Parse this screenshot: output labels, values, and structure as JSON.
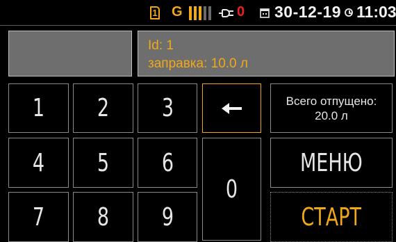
{
  "status": {
    "sim_number": "1",
    "network": "G",
    "signal_level": 0.6,
    "connection_status_value": "0",
    "date": "30-12-19",
    "time": "11:03",
    "icons": [
      "sim-icon",
      "signal-bars-icon",
      "plug-icon",
      "calendar-icon",
      "clock-icon"
    ],
    "colors": {
      "accent": "#f0a818",
      "alert": "#e8241c"
    }
  },
  "info": {
    "id_line": "Id: 1",
    "fuel_line": "заправка: 10.0 л"
  },
  "keypad": {
    "k1": "1",
    "k2": "2",
    "k3": "3",
    "k4": "4",
    "k5": "5",
    "k6": "6",
    "k7": "7",
    "k8": "8",
    "k9": "9",
    "k0": "0",
    "backspace_icon": "arrow-left-icon"
  },
  "total": {
    "label": "Всего отпущено:",
    "value": "20.0 л"
  },
  "menu_label": "МЕНЮ",
  "start_label": "СТАРТ"
}
